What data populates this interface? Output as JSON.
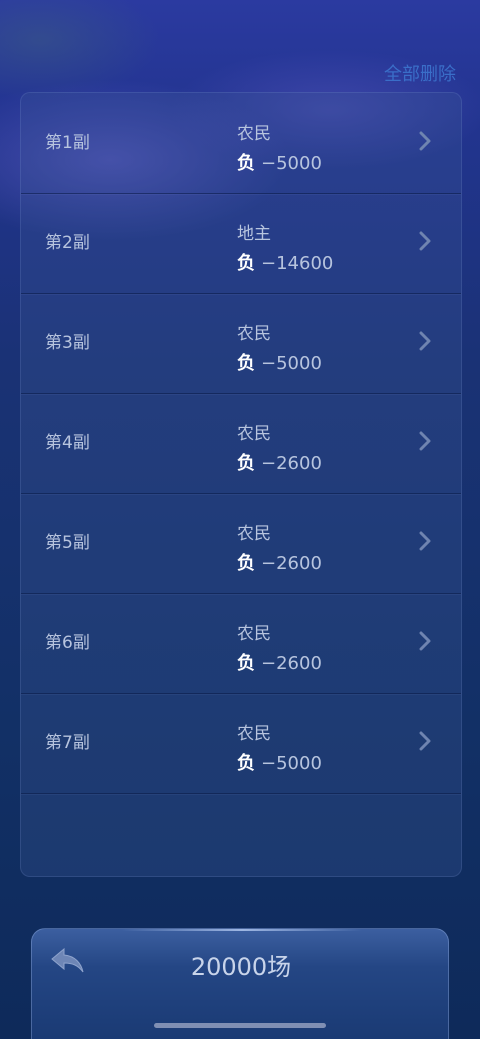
{
  "header": {
    "delete_all_label": "全部删除"
  },
  "records": [
    {
      "title": "第1副",
      "role": "农民",
      "result_label": "负",
      "score": "−5000"
    },
    {
      "title": "第2副",
      "role": "地主",
      "result_label": "负",
      "score": "−14600"
    },
    {
      "title": "第3副",
      "role": "农民",
      "result_label": "负",
      "score": "−5000"
    },
    {
      "title": "第4副",
      "role": "农民",
      "result_label": "负",
      "score": "−2600"
    },
    {
      "title": "第5副",
      "role": "农民",
      "result_label": "负",
      "score": "−2600"
    },
    {
      "title": "第6副",
      "role": "农民",
      "result_label": "负",
      "score": "−2600"
    },
    {
      "title": "第7副",
      "role": "农民",
      "result_label": "负",
      "score": "−5000"
    }
  ],
  "bottom_bar": {
    "title": "20000场",
    "back_icon": "back-arrow-icon"
  },
  "colors": {
    "accent_link": "#3a6ec8",
    "text_primary": "#b7c4de",
    "badge": "#ffffff"
  }
}
